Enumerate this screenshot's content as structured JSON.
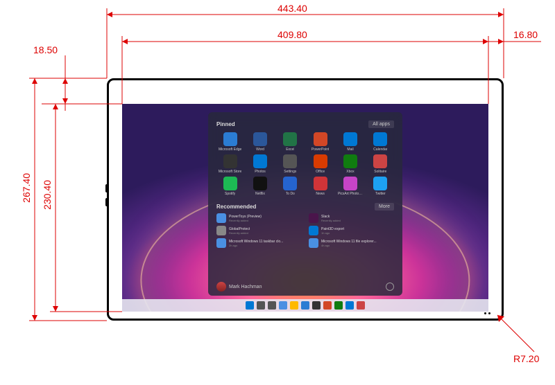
{
  "dimensions": {
    "outer_width": "443.40",
    "inner_width": "409.80",
    "outer_height": "267.40",
    "inner_height": "230.40",
    "bezel_top": "18.50",
    "bezel_right": "16.80",
    "corner_radius": "R7.20"
  },
  "start_menu": {
    "pinned_label": "Pinned",
    "all_apps_label": "All apps",
    "recommended_label": "Recommended",
    "more_label": "More",
    "apps": [
      {
        "label": "Microsoft Edge",
        "color": "#2b7cd3"
      },
      {
        "label": "Word",
        "color": "#2b579a"
      },
      {
        "label": "Excel",
        "color": "#217346"
      },
      {
        "label": "PowerPoint",
        "color": "#d24726"
      },
      {
        "label": "Mail",
        "color": "#0078d4"
      },
      {
        "label": "Calendar",
        "color": "#0078d4"
      },
      {
        "label": "Microsoft Store",
        "color": "#333333"
      },
      {
        "label": "Photos",
        "color": "#0078d4"
      },
      {
        "label": "Settings",
        "color": "#555555"
      },
      {
        "label": "Office",
        "color": "#d83b01"
      },
      {
        "label": "Xbox",
        "color": "#107c10"
      },
      {
        "label": "Solitaire",
        "color": "#c44"
      },
      {
        "label": "Spotify",
        "color": "#1db954"
      },
      {
        "label": "Netflix",
        "color": "#111111"
      },
      {
        "label": "To Do",
        "color": "#2564cf"
      },
      {
        "label": "News",
        "color": "#d13438"
      },
      {
        "label": "PicsArt Photo Studio",
        "color": "#c744c7"
      },
      {
        "label": "Twitter",
        "color": "#1da1f2"
      }
    ],
    "recommended": [
      {
        "title": "PowerToys (Preview)",
        "sub": "Recently added",
        "color": "#4a90e2"
      },
      {
        "title": "Slack",
        "sub": "Recently added",
        "color": "#4a154b"
      },
      {
        "title": "GlobalProtect",
        "sub": "Recently added",
        "color": "#888"
      },
      {
        "title": "Paint3D export",
        "sub": "1h ago",
        "color": "#0078d4"
      },
      {
        "title": "Microsoft Windows 11 taskbar clo...",
        "sub": "2h ago",
        "color": "#4a90e2"
      },
      {
        "title": "Microsoft Windows 11 file explorer...",
        "sub": "4h ago",
        "color": "#4a90e2"
      }
    ],
    "user_name": "Mark Hachman"
  },
  "taskbar_icons": [
    {
      "name": "start",
      "color": "#0078d4"
    },
    {
      "name": "search",
      "color": "#555"
    },
    {
      "name": "task-view",
      "color": "#555"
    },
    {
      "name": "widgets",
      "color": "#4a90e2"
    },
    {
      "name": "explorer",
      "color": "#ffb900"
    },
    {
      "name": "edge",
      "color": "#2b7cd3"
    },
    {
      "name": "store",
      "color": "#333"
    },
    {
      "name": "app1",
      "color": "#d24726"
    },
    {
      "name": "app2",
      "color": "#107c10"
    },
    {
      "name": "app3",
      "color": "#0078d4"
    },
    {
      "name": "app4",
      "color": "#c44"
    }
  ]
}
